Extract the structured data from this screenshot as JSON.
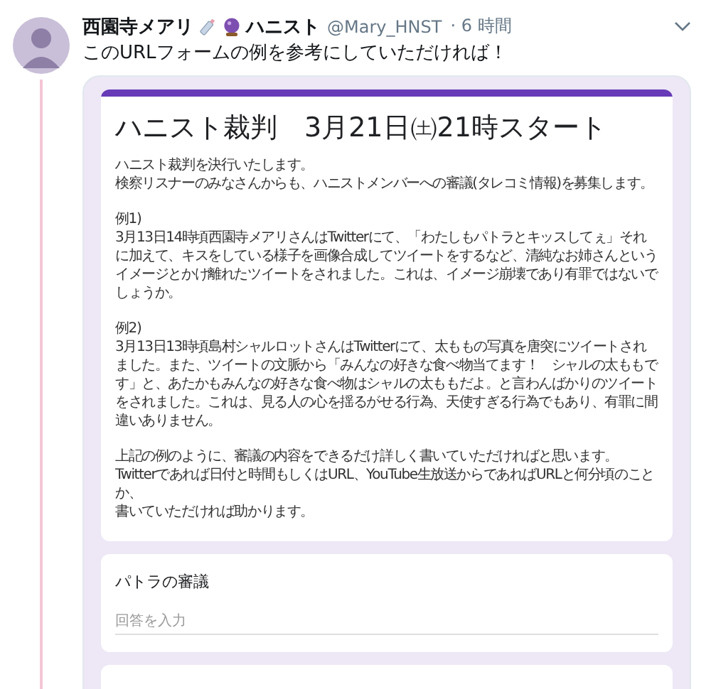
{
  "tweet": {
    "name_parts": [
      "西園寺メアリ",
      "ハニスト"
    ],
    "handle": "@Mary_HNST",
    "time": "· 6 時間",
    "text": "このURLフォームの例を参考にしていただければ！"
  },
  "form": {
    "title": "ハニスト裁判　3月21日㈯21時スタート",
    "paragraphs": [
      [
        "ハニスト裁判を決行いたします。",
        "検察リスナーのみなさんからも、ハニストメンバーへの審議(タレコミ情報)を募集します。"
      ],
      [
        "例1)",
        "3月13日14時頃西園寺メアリさんはTwitterにて、「わたしもパトラとキッスしてぇ」それに加えて、キスをしている様子を画像合成してツイートをするなど、清純なお姉さんというイメージとかけ離れたツイートをされました。これは、イメージ崩壊であり有罪ではないでしょうか。"
      ],
      [
        "例2)",
        "3月13日13時頃島村シャルロットさんはTwitterにて、太ももの写真を唐突にツイートされました。また、ツイートの文脈から「みんなの好きな食べ物当てます！　シャルの太ももです」と、あたかもみんなの好きな食べ物はシャルの太ももだよ。と言わんばかりのツイートをされました。これは、見る人の心を揺るがせる行為、天使すぎる行為でもあり、有罪に間違いありません。"
      ],
      [
        "上記の例のように、審議の内容をできるだけ詳しく書いていただければと思います。",
        "Twitterであれば日付と時間もしくはURL、YouTube生放送からであればURLと何分頃のことか、",
        "書いていただければ助かります。"
      ]
    ],
    "question": {
      "label": "パトラの審議",
      "placeholder": "回答を入力"
    }
  }
}
